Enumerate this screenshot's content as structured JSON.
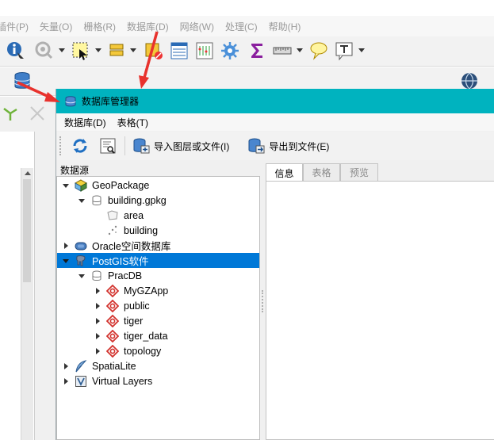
{
  "main_menu": {
    "items": [
      "插件(P)",
      "矢量(O)",
      "栅格(R)",
      "数据库(D)",
      "网络(W)",
      "处理(C)",
      "帮助(H)"
    ]
  },
  "db_manager": {
    "title": "数据库管理器",
    "menu": {
      "database": "数据库(D)",
      "table": "表格(T)"
    },
    "toolbar": {
      "refresh_icon": "refresh-icon",
      "sql_icon": "sql-window-icon",
      "import_label": "导入图层或文件(I)",
      "export_label": "导出到文件(E)"
    },
    "source_label": "数据源",
    "tree": {
      "geopackage": "GeoPackage",
      "building_gpkg": "building.gpkg",
      "area": "area",
      "building": "building",
      "oracle": "Oracle空间数据库",
      "postgis": "PostGIS软件",
      "pracdb": "PracDB",
      "mygzapp": "MyGZApp",
      "public": "public",
      "tiger": "tiger",
      "tiger_data": "tiger_data",
      "topology": "topology",
      "spatialite": "SpatiaLite",
      "virtual_layers": "Virtual Layers"
    },
    "tabs": {
      "info": "信息",
      "table": "表格",
      "preview": "预览"
    }
  },
  "colors": {
    "titlebar": "#00b3bf",
    "selection": "#0078d7",
    "annotation_arrow": "#e8322d"
  }
}
